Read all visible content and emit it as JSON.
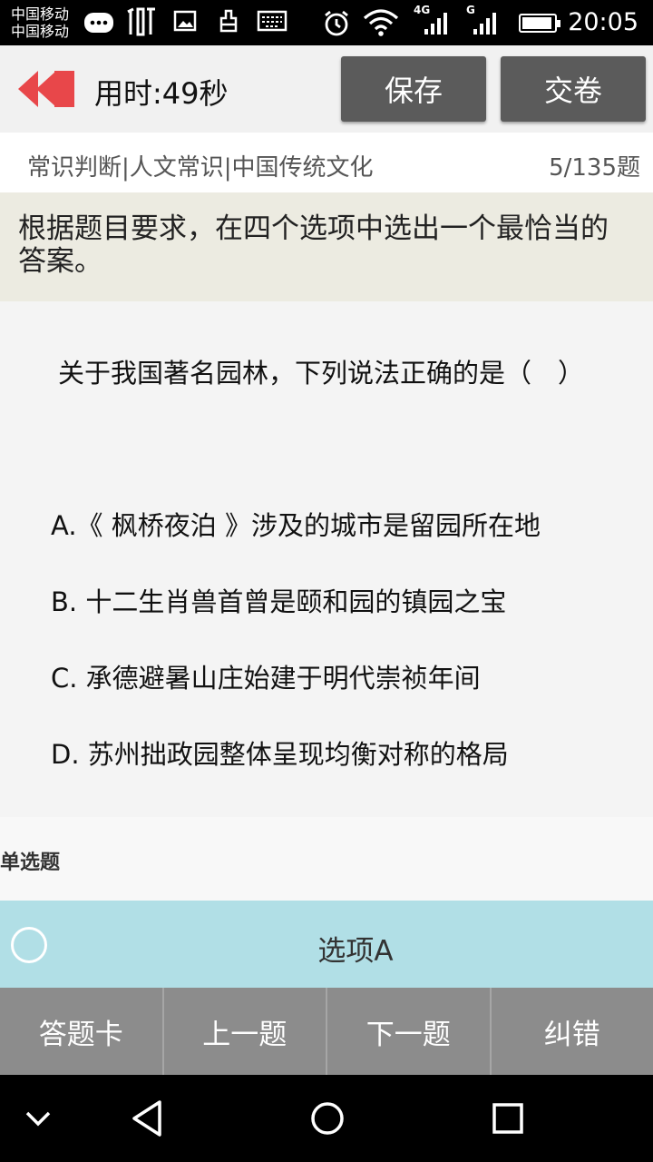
{
  "status": {
    "carrier_line1": "中国移动",
    "carrier_line2": "中国移动",
    "time": "20:05",
    "net1": "4G",
    "net2": "G"
  },
  "header": {
    "timer": "用时:49秒",
    "save_label": "保存",
    "submit_label": "交卷"
  },
  "category": {
    "path": "常识判断|人文常识|中国传统文化",
    "counter": "5/135题"
  },
  "instruction": "根据题目要求，在四个选项中选出一个最恰当的答案。",
  "question": {
    "text": "关于我国著名园林，下列说法正确的是（　）",
    "options": [
      "A.《 枫桥夜泊 》涉及的城市是留园所在地",
      "B. 十二生肖兽首曾是颐和园的镇园之宝",
      "C. 承德避暑山庄始建于明代崇祯年间",
      "D. 苏州拙政园整体呈现均衡对称的格局"
    ],
    "type": "单选题"
  },
  "answer": {
    "label": "选项A"
  },
  "bottom_nav": {
    "card": "答题卡",
    "prev": "上一题",
    "next": "下一题",
    "report": "纠错"
  },
  "colors": {
    "accent_back": "#e8474a",
    "button_bg": "#5b5b5b",
    "answer_bg": "#b1dfe6",
    "nav_bg": "#8c8c8c"
  }
}
